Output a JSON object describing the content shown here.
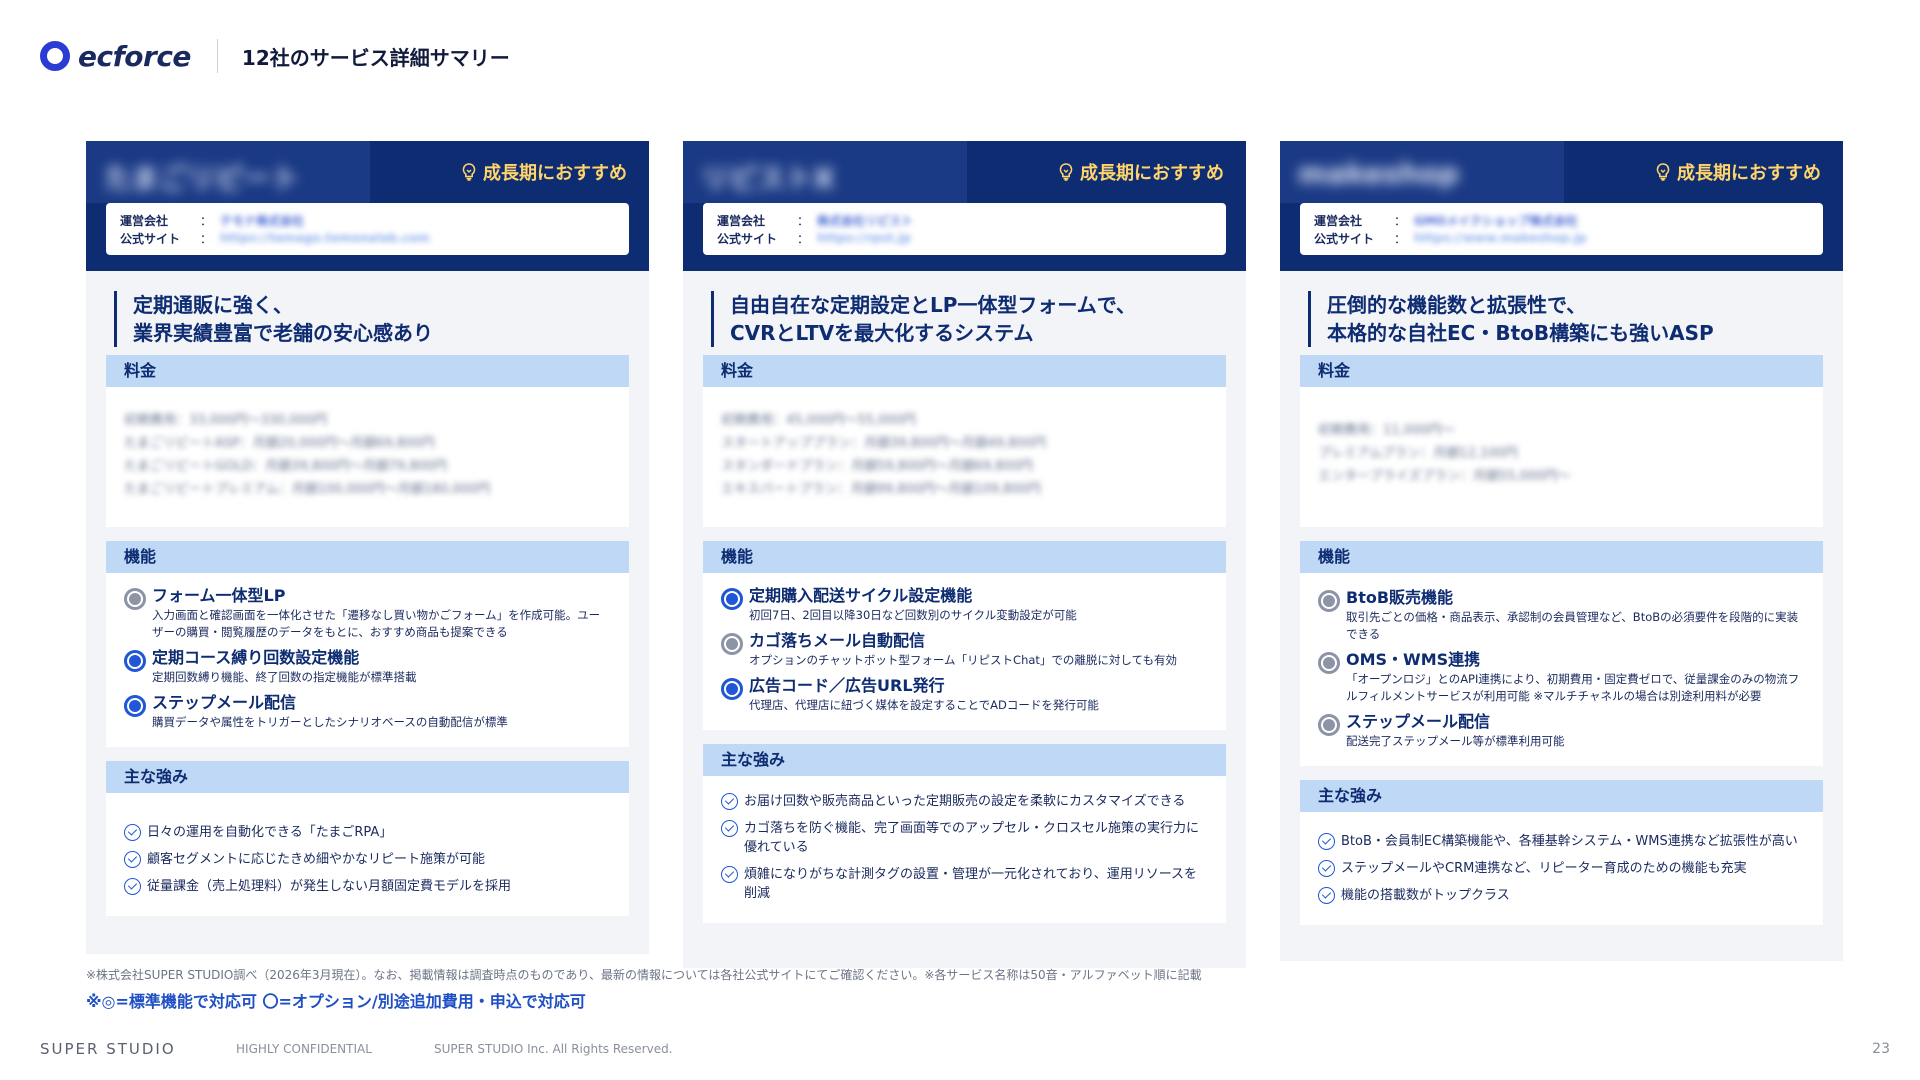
{
  "header": {
    "logo_text": "ecforce",
    "title": "12社のサービス詳細サマリー"
  },
  "cards": [
    {
      "service_name": "たまごリピート",
      "badge": "成長期におすすめ",
      "operator_label": "運営会社",
      "site_label": "公式サイト",
      "colon": "：",
      "operator_value": "テモナ株式会社",
      "site_value": "https://tamago.temonalab.com",
      "catch_line1": "定期通販に強く、",
      "catch_line2": "業界実績豊富で老舗の安心感あり",
      "price_title": "料金",
      "price_lines": [
        "初期費用：33,000円〜330,000円",
        "たまごリピートASP：月額20,000円〜月額69,800円",
        "たまごリピートGOLD：月額39,800円〜月額79,800円",
        "たまごリピートプレミアム：月額100,000円〜月額180,000円"
      ],
      "func_title": "機能",
      "features": [
        {
          "type": "opt",
          "title": "フォーム一体型LP",
          "desc": "入力画面と確認画面を一体化させた「遷移なし買い物かごフォーム」を作成可能。ユーザーの購買・閲覧履歴のデータをもとに、おすすめ商品も提案できる"
        },
        {
          "type": "std",
          "title": "定期コース縛り回数設定機能",
          "desc": "定期回数縛り機能、終了回数の指定機能が標準搭載"
        },
        {
          "type": "std",
          "title": "ステップメール配信",
          "desc": "購買データや属性をトリガーとしたシナリオベースの自動配信が標準"
        }
      ],
      "strength_title": "主な強み",
      "strengths": [
        "日々の運用を自動化できる「たまごRPA」",
        "顧客セグメントに応じたきめ細やかなリピート施策が可能",
        "従量課金（売上処理料）が発生しない月額固定費モデルを採用"
      ]
    },
    {
      "service_name": "リピストX",
      "badge": "成長期におすすめ",
      "operator_label": "運営会社",
      "site_label": "公式サイト",
      "colon": "：",
      "operator_value": "株式会社リピスト",
      "site_value": "https://rpst.jp",
      "catch_line1": "自由自在な定期設定とLP一体型フォームで、",
      "catch_line2": "CVRとLTVを最大化するシステム",
      "price_title": "料金",
      "price_lines": [
        "初期費用：45,000円〜55,000円",
        "スタートアッププラン：月額39,800円〜月額49,800円",
        "スタンダードプラン：月額59,800円〜月額69,800円",
        "エキスパートプラン：月額99,800円〜月額109,800円"
      ],
      "func_title": "機能",
      "features": [
        {
          "type": "std",
          "title": "定期購入配送サイクル設定機能",
          "desc": "初回7日、2回目以降30日など回数別のサイクル変動設定が可能"
        },
        {
          "type": "opt",
          "title": "カゴ落ちメール自動配信",
          "desc": "オプションのチャットボット型フォーム「リピストChat」での離脱に対しても有効"
        },
        {
          "type": "std",
          "title": "広告コード／広告URL発行",
          "desc": "代理店、代理店に紐づく媒体を設定することでADコードを発行可能"
        }
      ],
      "strength_title": "主な強み",
      "strengths": [
        "お届け回数や販売商品といった定期販売の設定を柔軟にカスタマイズできる",
        "カゴ落ちを防ぐ機能、完了画面等でのアップセル・クロスセル施策の実行力に優れている",
        "煩雑になりがちな計測タグの設置・管理が一元化されており、運用リソースを削減"
      ]
    },
    {
      "service_name": "makeshop",
      "badge": "成長期におすすめ",
      "operator_label": "運営会社",
      "site_label": "公式サイト",
      "colon": "：",
      "operator_value": "GMOメイクショップ株式会社",
      "site_value": "https://www.makeshop.jp",
      "catch_line1": "圧倒的な機能数と拡張性で、",
      "catch_line2": "本格的な自社EC・BtoB構築にも強いASP",
      "price_title": "料金",
      "price_lines": [
        "初期費用：11,000円〜",
        "プレミアムプラン：月額12,100円",
        "エンタープライズプラン：月額55,000円〜"
      ],
      "func_title": "機能",
      "features": [
        {
          "type": "opt",
          "title": "BtoB販売機能",
          "desc": "取引先ごとの価格・商品表示、承認制の会員管理など、BtoBの必須要件を段階的に実装できる"
        },
        {
          "type": "opt",
          "title": "OMS・WMS連携",
          "desc": "「オープンロジ」とのAPI連携により、初期費用・固定費ゼロで、従量課金のみの物流フルフィルメントサービスが利用可能 ※マルチチャネルの場合は別途利用料が必要"
        },
        {
          "type": "opt",
          "title": "ステップメール配信",
          "desc": "配送完了ステップメール等が標準利用可能"
        }
      ],
      "strength_title": "主な強み",
      "strengths": [
        "BtoB・会員制EC構築機能や、各種基幹システム・WMS連携など拡張性が高い",
        "ステップメールやCRM連携など、リピーター育成のための機能も充実",
        "機能の搭載数がトップクラス"
      ]
    }
  ],
  "note": "※株式会社SUPER STUDIO調べ（2026年3月現在）。なお、掲載情報は調査時点のものであり、最新の情報については各社公式サイトにてご確認ください。※各サービス名称は50音・アルファベット順に記載",
  "legend": "※◎=標準機能で対応可 〇=オプション/別途追加費用・申込で対応可",
  "footer": {
    "brand": "SUPER STUDIO",
    "confidential": "HIGHLY CONFIDENTIAL",
    "copyright": "SUPER STUDIO Inc. All Rights Reserved.",
    "page": "23"
  },
  "colors": {
    "navy": "#0e2c72",
    "accent_blue": "#1f57d6",
    "section_bg": "#bfd8f5",
    "badge_yellow": "#ffd46b"
  }
}
